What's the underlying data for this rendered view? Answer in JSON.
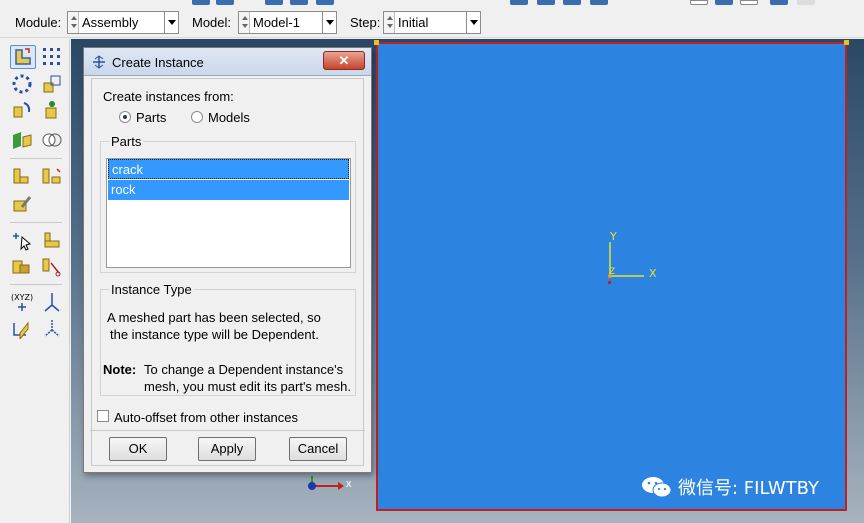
{
  "context_bar": {
    "module_label": "Module:",
    "module_value": "Assembly",
    "model_label": "Model:",
    "model_value": "Model-1",
    "step_label": "Step:",
    "step_value": "Initial"
  },
  "dialog": {
    "title": "Create Instance",
    "close_label": "✕",
    "create_from_label": "Create instances from:",
    "option_parts": "Parts",
    "option_models": "Models",
    "parts_group_title": "Parts",
    "parts": [
      "crack",
      "rock"
    ],
    "instance_type_title": "Instance Type",
    "instance_type_msg_1": "A meshed part has been selected, so",
    "instance_type_msg_2": "the instance type will be Dependent.",
    "note_label": "Note:",
    "note_msg_1": "To change a Dependent instance's",
    "note_msg_2": "mesh, you must edit its part's mesh.",
    "auto_offset_label": "Auto-offset from other instances",
    "ok_label": "OK",
    "apply_label": "Apply",
    "cancel_label": "Cancel"
  },
  "viewport": {
    "axis_y": "Y",
    "axis_x": "X",
    "axis_z": "Z",
    "global_x": "x"
  },
  "watermark": {
    "text": "微信号: FILWTBY"
  },
  "colors": {
    "part_fill": "#2c84e0",
    "selection": "#3399ff",
    "border_red": "#c02020"
  }
}
